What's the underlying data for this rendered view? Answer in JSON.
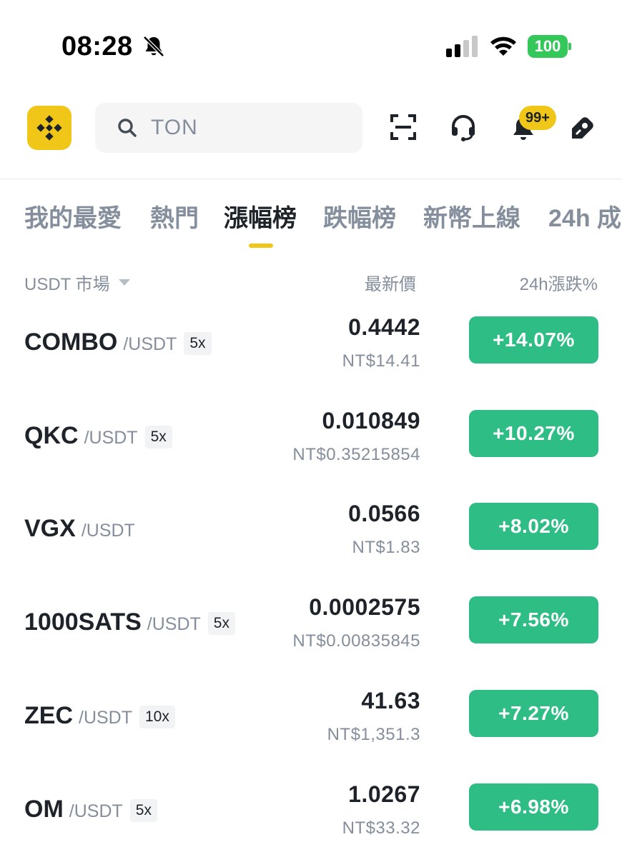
{
  "status_bar": {
    "time": "08:28",
    "battery": "100",
    "icons": [
      "bell-slash-icon",
      "cellular-signal-icon",
      "wifi-icon",
      "battery-icon"
    ]
  },
  "header": {
    "logo_icon": "binance-logo-icon",
    "search": {
      "value": "TON",
      "icon": "search-icon"
    },
    "icons": [
      "scan-icon",
      "headset-icon",
      "bell-icon",
      "gift-icon"
    ],
    "notification_badge": "99+"
  },
  "tabs": [
    {
      "label": "我的最愛",
      "active": false
    },
    {
      "label": "熱門",
      "active": false
    },
    {
      "label": "漲幅榜",
      "active": true
    },
    {
      "label": "跌幅榜",
      "active": false
    },
    {
      "label": "新幣上線",
      "active": false
    },
    {
      "label": "24h 成",
      "active": false
    }
  ],
  "columns": {
    "market": "USDT 市場",
    "price": "最新價",
    "change": "24h漲跌%"
  },
  "rows": [
    {
      "base": "COMBO",
      "quote": "/USDT",
      "leverage": "5x",
      "price": "0.4442",
      "fiat": "NT$14.41",
      "change": "+14.07%"
    },
    {
      "base": "QKC",
      "quote": "/USDT",
      "leverage": "5x",
      "price": "0.010849",
      "fiat": "NT$0.35215854",
      "change": "+10.27%"
    },
    {
      "base": "VGX",
      "quote": "/USDT",
      "leverage": "",
      "price": "0.0566",
      "fiat": "NT$1.83",
      "change": "+8.02%"
    },
    {
      "base": "1000SATS",
      "quote": "/USDT",
      "leverage": "5x",
      "price": "0.0002575",
      "fiat": "NT$0.00835845",
      "change": "+7.56%"
    },
    {
      "base": "ZEC",
      "quote": "/USDT",
      "leverage": "10x",
      "price": "41.63",
      "fiat": "NT$1,351.3",
      "change": "+7.27%"
    },
    {
      "base": "OM",
      "quote": "/USDT",
      "leverage": "5x",
      "price": "1.0267",
      "fiat": "NT$33.32",
      "change": "+6.98%"
    }
  ],
  "colors": {
    "brand_yellow": "#f0c718",
    "positive_green": "#2ebd85",
    "secondary_text": "#848e9c",
    "primary_text": "#1e2329"
  }
}
